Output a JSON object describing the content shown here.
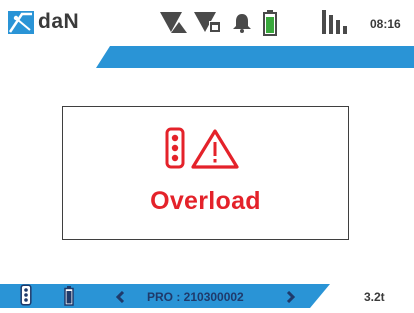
{
  "header": {
    "brand": "daN",
    "clock": "08:16",
    "icons": [
      "logo-icon",
      "signal-alert-icon",
      "signal-sim-icon",
      "bell-icon",
      "battery-icon",
      "signal-bars-icon"
    ]
  },
  "alert": {
    "label": "Overload",
    "icons": [
      "traffic-light-icon",
      "warning-triangle-icon"
    ]
  },
  "footer": {
    "device_id": "PRO : 210300002",
    "load_value": "3.2t",
    "icons": [
      "traffic-light-icon",
      "battery-icon",
      "prev-arrow-icon",
      "next-arrow-icon"
    ]
  },
  "colors": {
    "accent_blue": "#2a94d6",
    "alert_red": "#e4222a",
    "battery_green": "#39a83c",
    "icon_gray": "#4a4a4a"
  }
}
